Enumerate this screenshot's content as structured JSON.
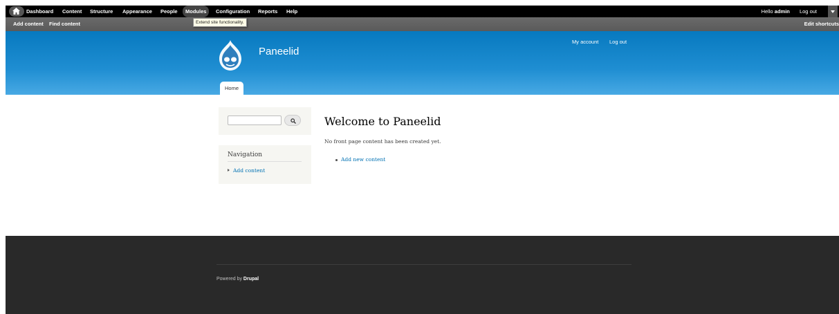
{
  "toolbar": {
    "menu": [
      "Dashboard",
      "Content",
      "Structure",
      "Appearance",
      "People",
      "Modules",
      "Configuration",
      "Reports",
      "Help"
    ],
    "active_item": "Modules",
    "greeting": "Hello",
    "username": "admin",
    "logout": "Log out",
    "home_icon": "home-icon",
    "toggle_icon": "chevron-down-icon"
  },
  "shortcuts": {
    "items": [
      "Add content",
      "Find content"
    ],
    "edit": "Edit shortcuts"
  },
  "tooltip": "Extend site functionality.",
  "header": {
    "site_name": "Paneelid",
    "secondary_menu": [
      "My account",
      "Log out"
    ],
    "tabs": [
      "Home"
    ],
    "colors": {
      "top": "#0779bf",
      "bottom": "#48a9e4"
    }
  },
  "sidebar": {
    "search_button_icon": "search-icon",
    "navigation_title": "Navigation",
    "navigation_links": [
      "Add content"
    ]
  },
  "main": {
    "title": "Welcome to Paneelid",
    "text": "No front page content has been created yet.",
    "links": [
      "Add new content"
    ]
  },
  "footer": {
    "powered_by": "Powered by",
    "brand": "Drupal"
  }
}
